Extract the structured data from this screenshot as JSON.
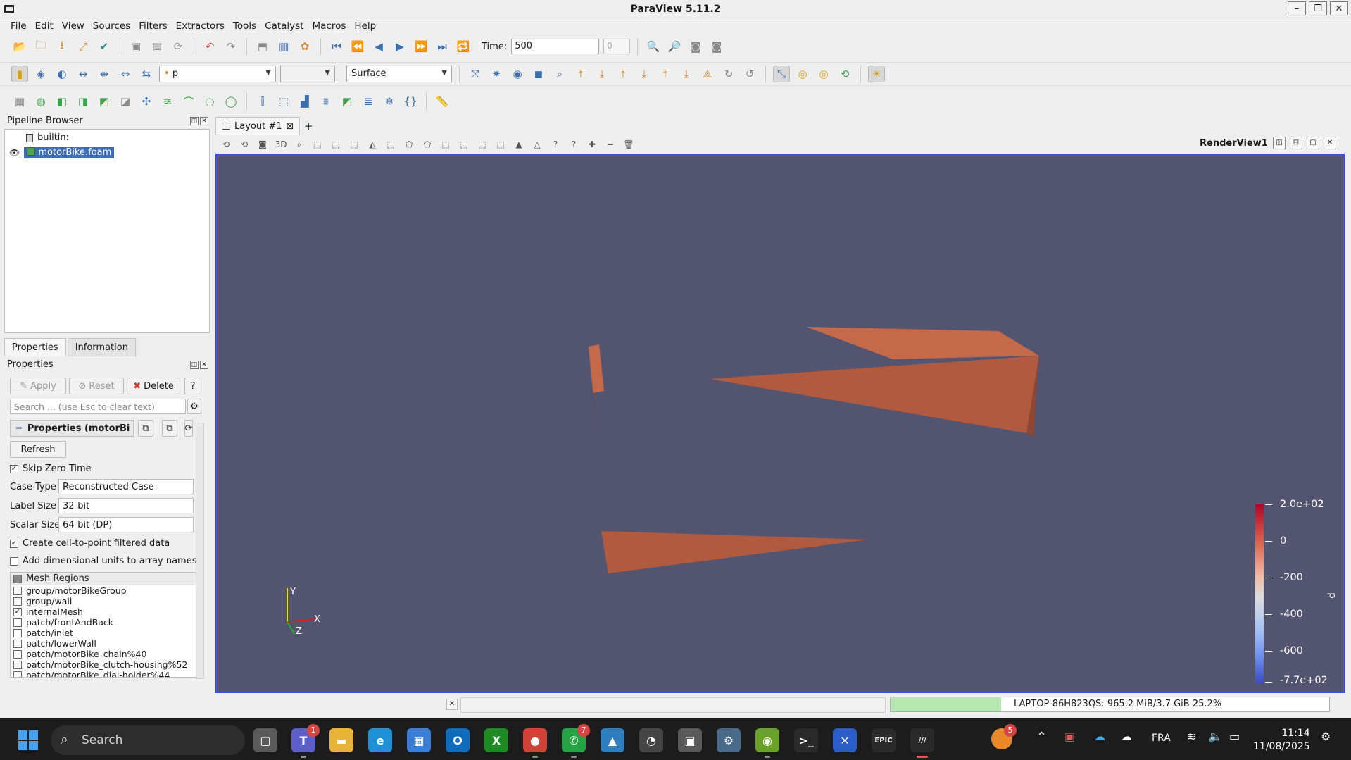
{
  "window": {
    "title": "ParaView 5.11.2"
  },
  "menu": [
    "File",
    "Edit",
    "View",
    "Sources",
    "Filters",
    "Extractors",
    "Tools",
    "Catalyst",
    "Macros",
    "Help"
  ],
  "toolbar": {
    "time_label": "Time:",
    "time_value": "500",
    "time_index": "0",
    "color_array": "p",
    "representation": "Surface"
  },
  "pipeline": {
    "title": "Pipeline Browser",
    "items": [
      {
        "label": "builtin:"
      },
      {
        "label": "motorBike.foam"
      }
    ]
  },
  "tabs": {
    "properties": "Properties",
    "information": "Information"
  },
  "properties": {
    "title": "Properties",
    "apply": "Apply",
    "reset": "Reset",
    "delete": "Delete",
    "help": "?",
    "search_placeholder": "Search ... (use Esc to clear text)",
    "section": "Properties (motorBi",
    "refresh": "Refresh",
    "skip_zero_time": "Skip Zero Time",
    "case_type_label": "Case Type",
    "case_type_value": "Reconstructed Case",
    "label_size_label": "Label Size",
    "label_size_value": "32-bit",
    "scalar_size_label": "Scalar Size",
    "scalar_size_value": "64-bit (DP)",
    "cell_to_point": "Create cell-to-point filtered data",
    "dimensional_units": "Add dimensional units to array names",
    "mesh_regions_header": "Mesh Regions",
    "mesh_regions": [
      {
        "label": "group/motorBikeGroup",
        "checked": ""
      },
      {
        "label": "group/wall",
        "checked": ""
      },
      {
        "label": "internalMesh",
        "checked": "✓"
      },
      {
        "label": "patch/frontAndBack",
        "checked": ""
      },
      {
        "label": "patch/inlet",
        "checked": ""
      },
      {
        "label": "patch/lowerWall",
        "checked": ""
      },
      {
        "label": "patch/motorBike_chain%40",
        "checked": ""
      },
      {
        "label": "patch/motorBike_clutch-housing%52",
        "checked": ""
      },
      {
        "label": "patch/motorBike_dial-holder%44",
        "checked": ""
      }
    ]
  },
  "layout": {
    "tab": "Layout #1",
    "plus": "+",
    "view_name": "RenderView1",
    "threeD": "3D"
  },
  "render": {
    "background": "#525470",
    "surface_color": "#c4694a",
    "axes": {
      "x": "X",
      "y": "Y",
      "z": "Z"
    },
    "scalar_bar": {
      "title": "p",
      "labels": [
        "2.0e+02",
        "0",
        "-200",
        "-400",
        "-600",
        "-7.7e+02"
      ]
    }
  },
  "status": {
    "memory_text": "LAPTOP-86H823QS: 965.2 MiB/3.7 GiB 25.2%",
    "memory_fraction": 0.252
  },
  "taskbar": {
    "search": "Search",
    "apps": [
      {
        "name": "task-view",
        "glyph": "▢",
        "color": "#5a5a5a",
        "badge": ""
      },
      {
        "name": "teams",
        "glyph": "T",
        "color": "#5b5fc7",
        "badge": "1"
      },
      {
        "name": "file-explorer",
        "glyph": "▬",
        "color": "#e8b33a",
        "badge": ""
      },
      {
        "name": "edge",
        "glyph": "e",
        "color": "#1f8fd6",
        "badge": ""
      },
      {
        "name": "store",
        "glyph": "▦",
        "color": "#3b7ed6",
        "badge": ""
      },
      {
        "name": "outlook",
        "glyph": "O",
        "color": "#0f6cbd",
        "badge": ""
      },
      {
        "name": "xbox",
        "glyph": "X",
        "color": "#1e8a24",
        "badge": ""
      },
      {
        "name": "chrome",
        "glyph": "●",
        "color": "#d04437",
        "badge": ""
      },
      {
        "name": "whatsapp",
        "glyph": "✆",
        "color": "#25a244",
        "badge": "7"
      },
      {
        "name": "photos",
        "glyph": "▲",
        "color": "#2f7fbf",
        "badge": ""
      },
      {
        "name": "clock-app",
        "glyph": "◔",
        "color": "#444",
        "badge": ""
      },
      {
        "name": "network-app",
        "glyph": "▣",
        "color": "#5a5a5a",
        "badge": ""
      },
      {
        "name": "settings",
        "glyph": "⚙",
        "color": "#4a6a8a",
        "badge": ""
      },
      {
        "name": "nvidia",
        "glyph": "◉",
        "color": "#6aa12a",
        "badge": ""
      },
      {
        "name": "terminal",
        "glyph": ">_",
        "color": "#2a2a2a",
        "badge": ""
      },
      {
        "name": "xmind",
        "glyph": "✕",
        "color": "#2b5cc7",
        "badge": ""
      },
      {
        "name": "epic-games",
        "glyph": "EPIC",
        "color": "#2a2a2a",
        "badge": ""
      },
      {
        "name": "paraview",
        "glyph": "///",
        "color": "#2a2a2a",
        "badge": ""
      }
    ],
    "tray_badge": "5",
    "language": "FRA",
    "time": "11:14",
    "date": "11/08/2025"
  }
}
